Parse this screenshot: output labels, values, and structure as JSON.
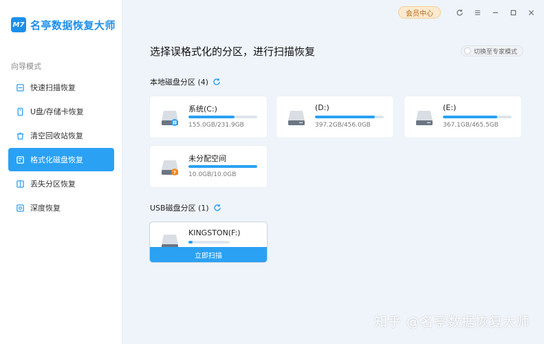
{
  "app": {
    "brand_logo": "M7",
    "brand_name": "名亭数据恢复大师"
  },
  "sidebar": {
    "section_label": "向导模式",
    "items": [
      {
        "label": "快速扫描恢复",
        "icon": "quick-scan-icon"
      },
      {
        "label": "U盘/存储卡恢复",
        "icon": "usb-icon"
      },
      {
        "label": "清空回收站恢复",
        "icon": "recycle-bin-icon"
      },
      {
        "label": "格式化磁盘恢复",
        "icon": "format-disk-icon",
        "active": true
      },
      {
        "label": "丢失分区恢复",
        "icon": "lost-partition-icon"
      },
      {
        "label": "深度恢复",
        "icon": "deep-recovery-icon"
      }
    ]
  },
  "topbar": {
    "member_label": "会员中心"
  },
  "main": {
    "title": "选择误格式化的分区，进行扫描恢复",
    "mode_switch_label": "切换至专家模式",
    "local_group_label": "本地磁盘分区 (4)",
    "usb_group_label": "USB磁盘分区 (1)",
    "local_disks": [
      {
        "name": "系统(C:)",
        "size": "155.0GB/231.9GB",
        "usage": 0.67,
        "badge": "windows"
      },
      {
        "name": "(D:)",
        "size": "397.2GB/456.0GB",
        "usage": 0.87,
        "badge": ""
      },
      {
        "name": "(E:)",
        "size": "367.1GB/465.5GB",
        "usage": 0.79,
        "badge": ""
      },
      {
        "name": "未分配空间",
        "size": "10.0GB/10.0GB",
        "usage": 1.0,
        "badge": "question"
      }
    ],
    "usb_disks": [
      {
        "name": "KINGSTON(F:)",
        "scan_label": "立即扫描"
      }
    ]
  },
  "watermark": "知乎 @名亭数据恢复大师",
  "colors": {
    "accent": "#2aa1f3",
    "background": "#eef4fa",
    "member_bg": "#fde9cf"
  }
}
